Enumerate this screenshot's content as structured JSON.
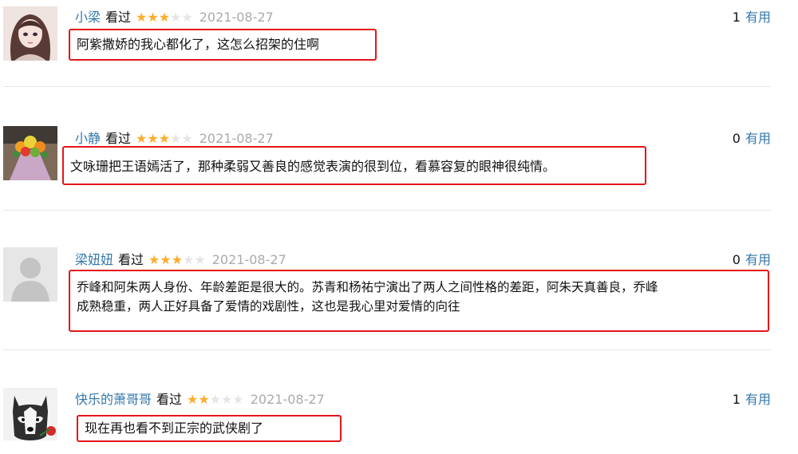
{
  "reviews": [
    {
      "username": "小梁",
      "watched_label": "看过",
      "rating": 3,
      "stars_filled": "★★★",
      "stars_empty": "★★",
      "date": "2021-08-27",
      "useful_count": "1",
      "useful_label": "有用",
      "avatar": "anime-girl-avatar",
      "content": "阿紫撒娇的我心都化了，这怎么招架的住啊"
    },
    {
      "username": "小静",
      "watched_label": "看过",
      "rating": 3,
      "stars_filled": "★★★",
      "stars_empty": "★★",
      "date": "2021-08-27",
      "useful_count": "0",
      "useful_label": "有用",
      "avatar": "flower-bouquet-avatar",
      "content": "文咏珊把王语嫣活了，那种柔弱又善良的感觉表演的很到位，看慕容复的眼神很纯情。"
    },
    {
      "username": "梁妞妞",
      "watched_label": "看过",
      "rating": 3,
      "stars_filled": "★★★",
      "stars_empty": "★★",
      "date": "2021-08-27",
      "useful_count": "0",
      "useful_label": "有用",
      "avatar": "default-user-avatar",
      "content_lines": [
        "乔峰和阿朱两人身份、年龄差距是很大的。苏青和杨祐宁演出了两人之间性格的差距，阿朱天真善良，乔峰",
        "成熟稳重，两人正好具备了爱情的戏剧性，这也是我心里对爱情的向往"
      ]
    },
    {
      "username": "快乐的萧哥哥",
      "watched_label": "看过",
      "rating": 2,
      "stars_filled": "★★",
      "stars_empty": "★★★",
      "date": "2021-08-27",
      "useful_count": "1",
      "useful_label": "有用",
      "avatar": "husky-dog-avatar",
      "content": "现在再也看不到正宗的武侠剧了"
    }
  ],
  "colors": {
    "link": "#3377aa",
    "star_on": "#ffac2d",
    "star_off": "#e5e5e5",
    "highlight_border": "#e3161a",
    "date": "#aaaaaa"
  }
}
